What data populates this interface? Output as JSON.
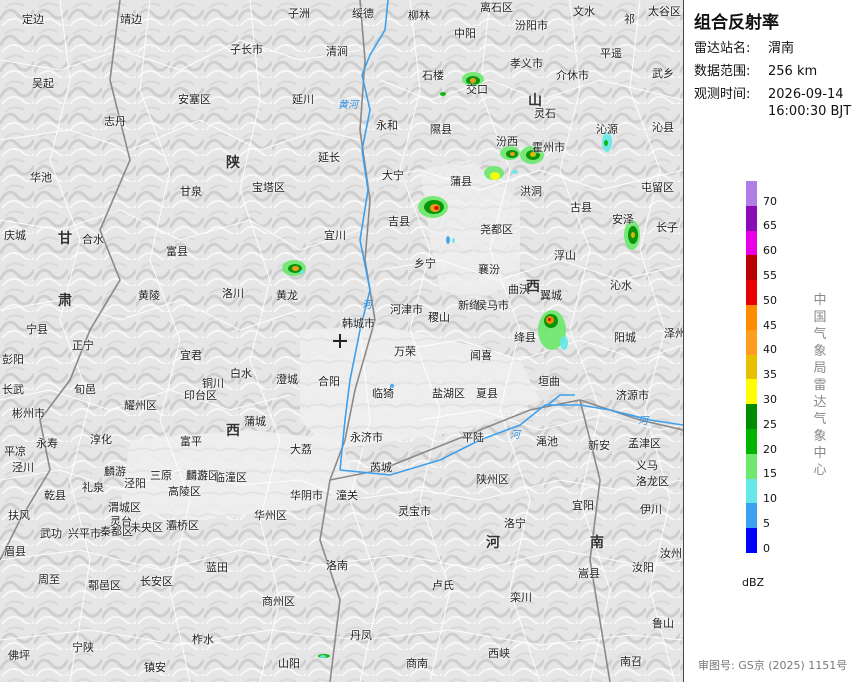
{
  "panel": {
    "title": "组合反射率",
    "station_label": "雷达站名:",
    "station_value": "渭南",
    "range_label": "数据范围:",
    "range_value": "256 km",
    "time_label": "观测时间:",
    "time_date": "2026-09-14",
    "time_clock": "16:00:30 BJT",
    "unit": "dBZ",
    "center_name": "中国气象局雷达气象中心",
    "approval": "审图号: GS京 (2025) 1151号"
  },
  "legend": [
    {
      "value": "70",
      "color": "#b17ee6"
    },
    {
      "value": "65",
      "color": "#8a0bb5"
    },
    {
      "value": "60",
      "color": "#e800e8"
    },
    {
      "value": "55",
      "color": "#b80000"
    },
    {
      "value": "50",
      "color": "#e80000"
    },
    {
      "value": "45",
      "color": "#ff8c00"
    },
    {
      "value": "40",
      "color": "#ff9e1c"
    },
    {
      "value": "35",
      "color": "#e8c000"
    },
    {
      "value": "30",
      "color": "#ffff00"
    },
    {
      "value": "25",
      "color": "#008c00"
    },
    {
      "value": "20",
      "color": "#00b400"
    },
    {
      "value": "15",
      "color": "#6ee86e"
    },
    {
      "value": "10",
      "color": "#66e8e8"
    },
    {
      "value": "5",
      "color": "#3aa0f0"
    },
    {
      "value": "0",
      "color": "#0000ff"
    }
  ],
  "places": [
    {
      "name": "定边"
    },
    {
      "name": "靖边"
    },
    {
      "name": "子洲"
    },
    {
      "name": "绥德"
    },
    {
      "name": "柳林"
    },
    {
      "name": "离石区"
    },
    {
      "name": "文水"
    },
    {
      "name": "祁"
    },
    {
      "name": "太谷区"
    },
    {
      "name": "中阳"
    },
    {
      "name": "汾阳市"
    },
    {
      "name": "子长市"
    },
    {
      "name": "清涧"
    },
    {
      "name": "孝义市"
    },
    {
      "name": "平遥"
    },
    {
      "name": "吴起"
    },
    {
      "name": "安塞区"
    },
    {
      "name": "延川"
    },
    {
      "name": "石楼"
    },
    {
      "name": "介休市"
    },
    {
      "name": "武乡"
    },
    {
      "name": "交口"
    },
    {
      "name": "志丹"
    },
    {
      "name": "永和"
    },
    {
      "name": "隰县"
    },
    {
      "name": "灵石"
    },
    {
      "name": "沁源"
    },
    {
      "name": "沁县"
    },
    {
      "name": "汾西"
    },
    {
      "name": "霍州市"
    },
    {
      "name": "延长"
    },
    {
      "name": "华池"
    },
    {
      "name": "甘泉"
    },
    {
      "name": "宝塔区"
    },
    {
      "name": "大宁"
    },
    {
      "name": "蒲县"
    },
    {
      "name": "洪洞"
    },
    {
      "name": "屯留区"
    },
    {
      "name": "古县"
    },
    {
      "name": "安泽"
    },
    {
      "name": "吉县"
    },
    {
      "name": "尧都区"
    },
    {
      "name": "长子"
    },
    {
      "name": "庆城"
    },
    {
      "name": "合水"
    },
    {
      "name": "富县"
    },
    {
      "name": "宜川"
    },
    {
      "name": "浮山"
    },
    {
      "name": "乡宁"
    },
    {
      "name": "襄汾"
    },
    {
      "name": "曲沃"
    },
    {
      "name": "翼城"
    },
    {
      "name": "沁水"
    },
    {
      "name": "洛川"
    },
    {
      "name": "黄龙"
    },
    {
      "name": "黄陵"
    },
    {
      "name": "宁县"
    },
    {
      "name": "韩城市"
    },
    {
      "name": "河津市"
    },
    {
      "name": "稷山"
    },
    {
      "name": "新绛"
    },
    {
      "name": "侯马市"
    },
    {
      "name": "绛县"
    },
    {
      "name": "阳城"
    },
    {
      "name": "泽州"
    },
    {
      "name": "正宁"
    },
    {
      "name": "宜君"
    },
    {
      "name": "万荣"
    },
    {
      "name": "闻喜"
    },
    {
      "name": "垣曲"
    },
    {
      "name": "白水"
    },
    {
      "name": "澄城"
    },
    {
      "name": "合阳"
    },
    {
      "name": "旬邑"
    },
    {
      "name": "铜川"
    },
    {
      "name": "印台区"
    },
    {
      "name": "临猗"
    },
    {
      "name": "盐湖区"
    },
    {
      "name": "夏县"
    },
    {
      "name": "济源市"
    },
    {
      "name": "彬州市"
    },
    {
      "name": "耀州区"
    },
    {
      "name": "蒲城"
    },
    {
      "name": "永寿"
    },
    {
      "name": "淳化"
    },
    {
      "name": "富平"
    },
    {
      "name": "大荔"
    },
    {
      "name": "永济市"
    },
    {
      "name": "平陆"
    },
    {
      "name": "渑池"
    },
    {
      "name": "新安"
    },
    {
      "name": "孟津区"
    },
    {
      "name": "麟游"
    },
    {
      "name": "三原"
    },
    {
      "name": "阎良区"
    },
    {
      "name": "临潼区"
    },
    {
      "name": "芮城"
    },
    {
      "name": "陕州区"
    },
    {
      "name": "义马"
    },
    {
      "name": "洛龙区"
    },
    {
      "name": "乾县"
    },
    {
      "name": "礼泉"
    },
    {
      "name": "泾阳"
    },
    {
      "name": "高陵区"
    },
    {
      "name": "渭城区"
    },
    {
      "name": "华阴市"
    },
    {
      "name": "潼关"
    },
    {
      "name": "宜阳"
    },
    {
      "name": "伊川"
    },
    {
      "name": "扶风"
    },
    {
      "name": "武功"
    },
    {
      "name": "兴平市"
    },
    {
      "name": "秦都区"
    },
    {
      "name": "未央区"
    },
    {
      "name": "灞桥区"
    },
    {
      "name": "华州区"
    },
    {
      "name": "灵宝市"
    },
    {
      "name": "洛宁"
    },
    {
      "name": "汝州"
    },
    {
      "name": "周至"
    },
    {
      "name": "鄠邑区"
    },
    {
      "name": "长安区"
    },
    {
      "name": "蓝田"
    },
    {
      "name": "洛南"
    },
    {
      "name": "卢氏"
    },
    {
      "name": "栾川"
    },
    {
      "name": "嵩县"
    },
    {
      "name": "汝阳"
    },
    {
      "name": "商州区"
    },
    {
      "name": "柞水"
    },
    {
      "name": "宁陕"
    },
    {
      "name": "镇安"
    },
    {
      "name": "丹凤"
    },
    {
      "name": "山阳"
    },
    {
      "name": "商南"
    },
    {
      "name": "西峡"
    },
    {
      "name": "南召"
    },
    {
      "name": "鲁山"
    },
    {
      "name": "佛坪"
    },
    {
      "name": "眉县"
    },
    {
      "name": "彭阳"
    },
    {
      "name": "长武"
    },
    {
      "name": "麟游"
    },
    {
      "name": "泾川"
    },
    {
      "name": "平凉"
    },
    {
      "name": "灵台"
    }
  ],
  "regions": [
    {
      "name": "陕"
    },
    {
      "name": "西"
    },
    {
      "name": "山"
    },
    {
      "name": "西"
    },
    {
      "name": "甘"
    },
    {
      "name": "肃"
    },
    {
      "name": "河"
    },
    {
      "name": "南"
    }
  ],
  "rivers": [
    {
      "name": "黄河"
    },
    {
      "name": "河"
    },
    {
      "name": "河"
    },
    {
      "name": "河"
    }
  ]
}
